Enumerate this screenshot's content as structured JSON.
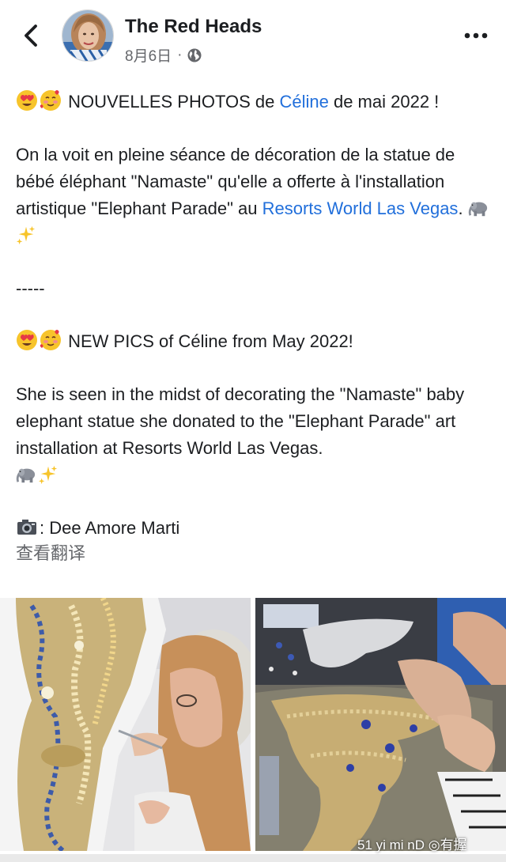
{
  "header": {
    "back_icon": "chevron-left-icon",
    "page_name": "The Red Heads",
    "date": "8月6日",
    "separator": "·",
    "audience_icon": "globe-icon",
    "more_icon": "more-horizontal-icon"
  },
  "post": {
    "p1": {
      "emojis": [
        "heart-eyes-emoji",
        "smiling-face-with-hearts-emoji"
      ],
      "text_before": " NOUVELLES PHOTOS de ",
      "link": "Céline",
      "text_after": " de mai 2022 !"
    },
    "p2": {
      "text": "On la voit en pleine séance de décoration de la statue de bébé éléphant \"Namaste\" qu'elle a offerte à l'installation artistique \"Elephant Parade\" au ",
      "link": "Resorts World Las Vegas",
      "text_after": ". ",
      "emojis": [
        "elephant-emoji",
        "sparkles-emoji"
      ]
    },
    "divider": "-----",
    "p3": {
      "emojis": [
        "heart-eyes-emoji",
        "smiling-face-with-hearts-emoji"
      ],
      "text": " NEW PICS of Céline from May 2022!"
    },
    "p4": {
      "text": "She is seen in the midst of decorating the \"Namaste\" baby elephant statue she donated to the \"Elephant Parade\" art installation at Resorts World Las Vegas.",
      "emojis": [
        "elephant-emoji",
        "sparkles-emoji"
      ]
    },
    "credit": {
      "emoji": "camera-emoji",
      "text": ": Dee Amore Marti"
    },
    "translate_label": "查看翻译"
  },
  "photos": [
    {
      "description_icon": "photo-decorating-statue"
    },
    {
      "description_icon": "photo-jewels-fabric"
    }
  ],
  "watermark": "51 yi mi nD ◎有握",
  "colors": {
    "link": "#216fdb",
    "secondary_text": "#65676b",
    "primary_text": "#1c1e21"
  }
}
